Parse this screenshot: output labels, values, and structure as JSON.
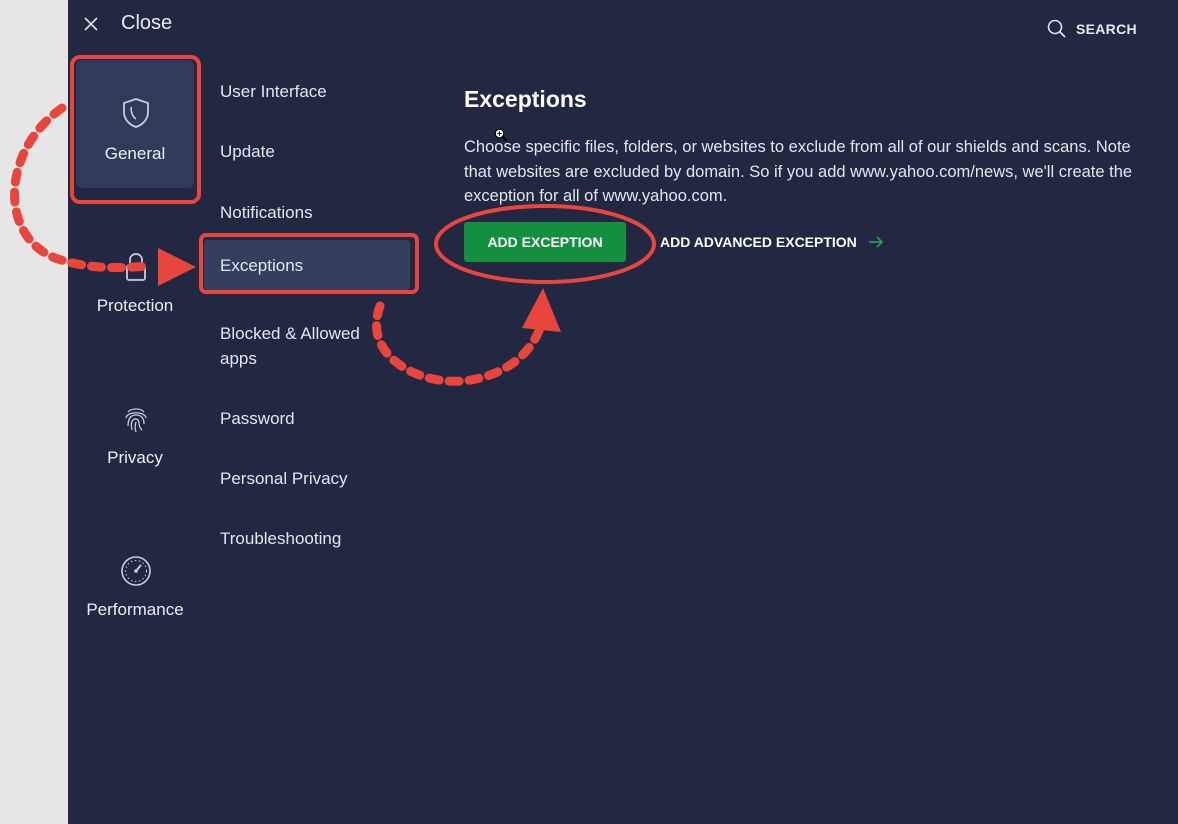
{
  "header": {
    "close_label": "Close",
    "search_label": "SEARCH"
  },
  "categories": [
    {
      "label": "General",
      "icon": "shield-icon"
    },
    {
      "label": "Protection",
      "icon": "lock-icon"
    },
    {
      "label": "Privacy",
      "icon": "fingerprint-icon"
    },
    {
      "label": "Performance",
      "icon": "speedometer-icon"
    }
  ],
  "subnav": [
    {
      "label": "User Interface"
    },
    {
      "label": "Update"
    },
    {
      "label": "Notifications"
    },
    {
      "label": "Exceptions"
    },
    {
      "label": "Blocked & Allowed apps"
    },
    {
      "label": "Password"
    },
    {
      "label": "Personal Privacy"
    },
    {
      "label": "Troubleshooting"
    }
  ],
  "content": {
    "title": "Exceptions",
    "description": "Choose specific files, folders, or websites to exclude from all of our shields and scans. Note that websites are excluded by domain. So if you add www.yahoo.com/news, we'll create the exception for all of www.yahoo.com.",
    "add_button": "ADD EXCEPTION",
    "advanced_link": "ADD ADVANCED EXCEPTION"
  },
  "colors": {
    "background": "#222842",
    "accent_green": "#148f3d",
    "annotation_red": "#e8453c"
  }
}
